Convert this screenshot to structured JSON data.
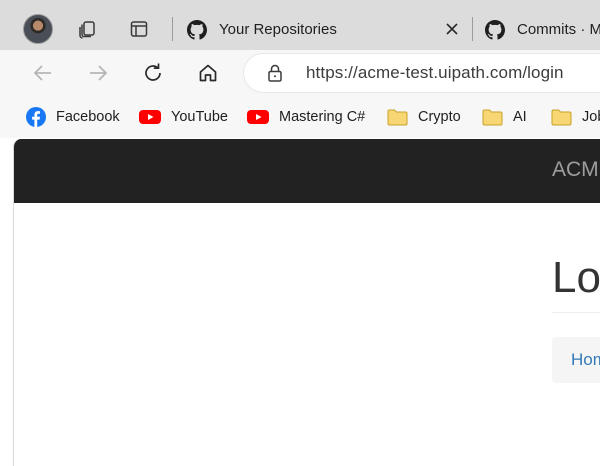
{
  "browser": {
    "tabs": [
      {
        "title": "Your Repositories",
        "icon": "github-icon"
      },
      {
        "title": "Commits · M",
        "icon": "github-icon"
      }
    ],
    "address": {
      "url": "https://acme-test.uipath.com/login"
    },
    "bookmarks": [
      {
        "label": "Facebook",
        "icon": "facebook-icon"
      },
      {
        "label": "YouTube",
        "icon": "youtube-icon"
      },
      {
        "label": "Mastering C#",
        "icon": "youtube-icon"
      },
      {
        "label": "Crypto",
        "icon": "folder-icon"
      },
      {
        "label": "AI",
        "icon": "folder-icon"
      },
      {
        "label": "Job",
        "icon": "folder-icon"
      }
    ],
    "colors": {
      "facebook": "#1877f2",
      "youtube": "#ff0000",
      "folder": "#f2c94c",
      "link": "#337ab7",
      "navbar": "#222222"
    }
  },
  "page": {
    "brand": "ACM",
    "title": "Lo",
    "breadcrumb": {
      "home": "Hom"
    }
  }
}
